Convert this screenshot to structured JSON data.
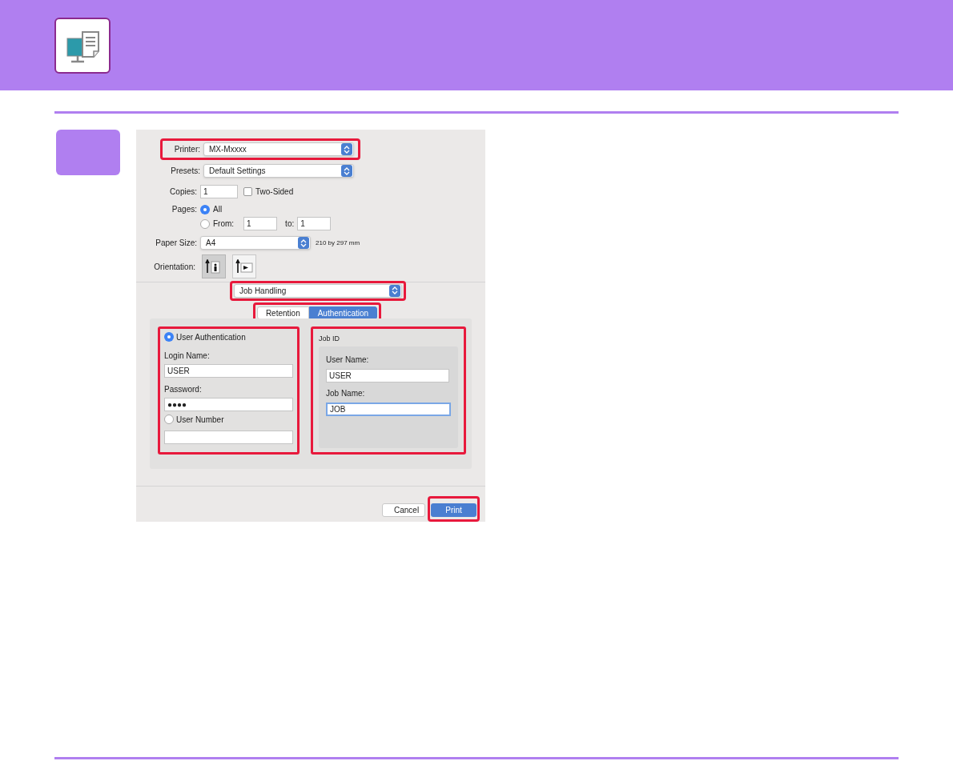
{
  "dialog": {
    "printer": {
      "label": "Printer:",
      "value": "MX-Mxxxx",
      "highlighted": true
    },
    "presets": {
      "label": "Presets:",
      "value": "Default Settings"
    },
    "copies": {
      "label": "Copies:",
      "value": "1",
      "two_sided": {
        "label": "Two-Sided",
        "checked": false
      }
    },
    "pages": {
      "label": "Pages:",
      "options": [
        {
          "label": "All",
          "selected": true
        },
        {
          "label": "From:",
          "selected": false
        }
      ],
      "from": "1",
      "to_label": "to:",
      "to": "1"
    },
    "paper_size": {
      "label": "Paper Size:",
      "value": "A4",
      "note": "210 by 297 mm"
    },
    "orientation": {
      "label": "Orientation:",
      "options": [
        {
          "kind": "portrait",
          "selected": true
        },
        {
          "kind": "landscape",
          "selected": false
        }
      ]
    },
    "section_menu": {
      "value": "Job Handling",
      "highlighted": true
    },
    "tabs": [
      {
        "label": "Retention",
        "selected": false
      },
      {
        "label": "Authentication",
        "selected": true
      }
    ],
    "authentication": {
      "modes": [
        {
          "label": "User Authentication",
          "selected": true
        },
        {
          "label": "User Number",
          "selected": false
        }
      ],
      "login_label": "Login Name:",
      "login": "USER",
      "password_label": "Password:",
      "password": "●●●●"
    },
    "job_id": {
      "title": "Job ID",
      "user_name_label": "User Name:",
      "user_name": "USER",
      "job_name_label": "Job Name:",
      "job_name": "JOB",
      "job_name_focused": true
    },
    "buttons": [
      {
        "label": "Cancel",
        "kind": "cancel",
        "highlighted": false
      },
      {
        "label": "Print",
        "kind": "default",
        "highlighted": true
      }
    ]
  }
}
